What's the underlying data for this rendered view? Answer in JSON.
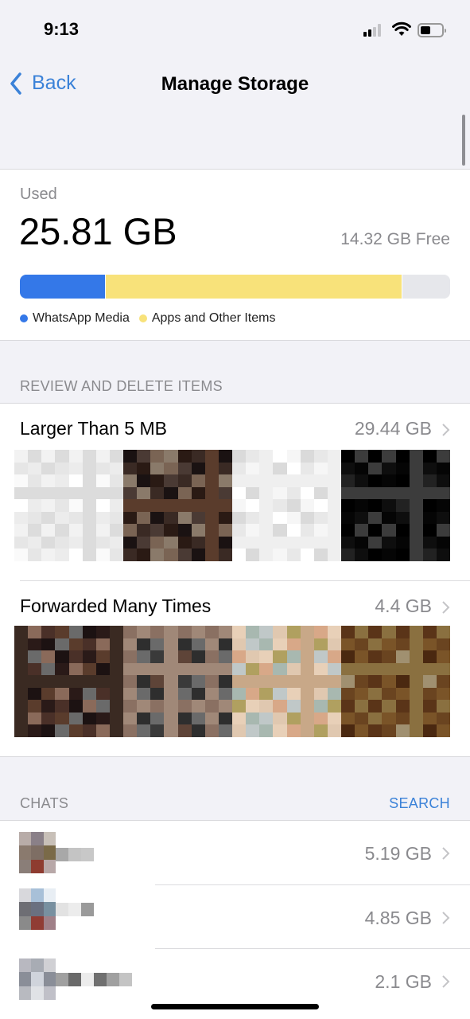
{
  "status_bar": {
    "time": "9:13",
    "signal_bars_active": 2,
    "signal_bars_total": 4,
    "battery_percent": 40
  },
  "nav": {
    "back_label": "Back",
    "title": "Manage Storage"
  },
  "storage": {
    "used_label": "Used",
    "used_value": "25.81 GB",
    "free_value": "14.32 GB Free",
    "bar": [
      {
        "name": "WhatsApp Media",
        "fraction": 0.2,
        "color": "#3478e8"
      },
      {
        "name": "Apps and Other Items",
        "fraction": 0.69,
        "color": "#f8e27a"
      },
      {
        "name": "Free",
        "fraction": 0.11,
        "color": "#e6e7eb"
      }
    ],
    "legend": [
      {
        "label": "WhatsApp Media",
        "color": "#3478e8"
      },
      {
        "label": "Apps and Other Items",
        "color": "#f8e27a"
      }
    ]
  },
  "review": {
    "header": "REVIEW AND DELETE ITEMS",
    "items": [
      {
        "title": "Larger Than 5 MB",
        "value": "29.44 GB"
      },
      {
        "title": "Forwarded Many Times",
        "value": "4.4 GB"
      }
    ]
  },
  "chats": {
    "header": "CHATS",
    "search_label": "SEARCH",
    "items": [
      {
        "size": "5.19 GB"
      },
      {
        "size": "4.85 GB"
      },
      {
        "size": "2.1 GB"
      }
    ]
  }
}
